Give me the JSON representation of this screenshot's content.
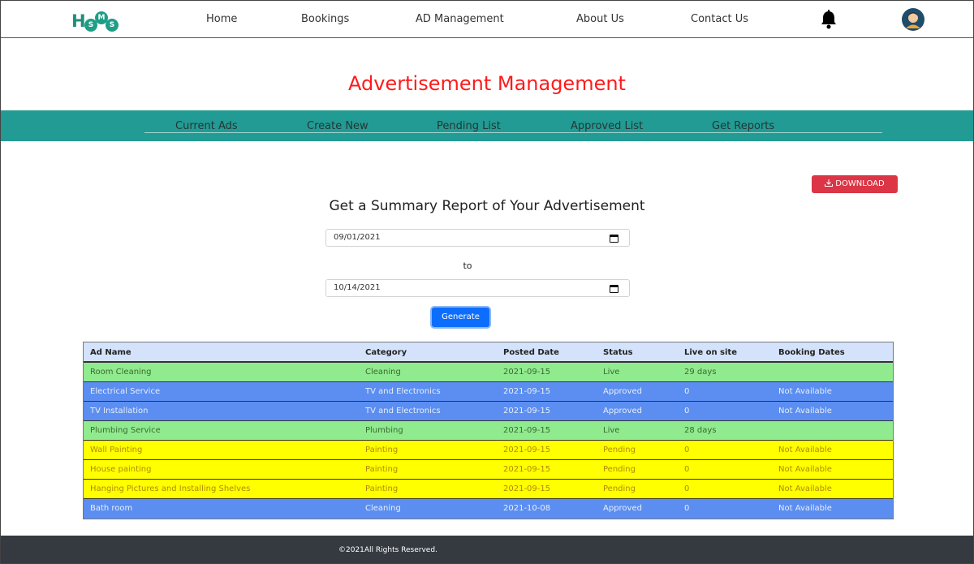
{
  "nav": {
    "logo_h": "H",
    "logo_m": "M",
    "logo_s1": "S",
    "logo_s2": "S",
    "links": [
      "Home",
      "Bookings",
      "AD Management",
      "About Us",
      "Contact Us"
    ],
    "icons": [
      "bell-icon",
      "avatar-icon"
    ]
  },
  "page_title": "Advertisement Management",
  "tabs": [
    "Current Ads",
    "Create New",
    "Pending List",
    "Approved List",
    "Get Reports"
  ],
  "download_label": "DOWNLOAD",
  "summary_title": "Get a Summary Report of Your Advertisement",
  "date_from": "09/01/2021",
  "to_label": "to",
  "date_to": "10/14/2021",
  "generate_label": "Generate",
  "table": {
    "headers": [
      "Ad Name",
      "Category",
      "Posted Date",
      "Status",
      "Live on site",
      "Booking Dates"
    ],
    "rows": [
      {
        "name": "Room Cleaning",
        "category": "Cleaning",
        "date": "2021-09-15",
        "status": "Live",
        "live": "29 days",
        "booking": "",
        "color": "#90ea8e"
      },
      {
        "name": "Electrical Service",
        "category": "TV and Electronics",
        "date": "2021-09-15",
        "status": "Approved",
        "live": "0",
        "booking": "Not Available",
        "color": "#5b8ef0"
      },
      {
        "name": "TV Installation",
        "category": "TV and Electronics",
        "date": "2021-09-15",
        "status": "Approved",
        "live": "0",
        "booking": "Not Available",
        "color": "#5b8ef0"
      },
      {
        "name": "Plumbing Service",
        "category": "Plumbing",
        "date": "2021-09-15",
        "status": "Live",
        "live": "28 days",
        "booking": "",
        "color": "#90ea8e"
      },
      {
        "name": "Wall Painting",
        "category": "Painting",
        "date": "2021-09-15",
        "status": "Pending",
        "live": "0",
        "booking": "Not Available",
        "color": "#ffff00"
      },
      {
        "name": "House painting",
        "category": "Painting",
        "date": "2021-09-15",
        "status": "Pending",
        "live": "0",
        "booking": "Not Available",
        "color": "#ffff00"
      },
      {
        "name": "Hanging Pictures and Installing Shelves",
        "category": "Painting",
        "date": "2021-09-15",
        "status": "Pending",
        "live": "0",
        "booking": "Not Available",
        "color": "#ffff00"
      },
      {
        "name": "Bath room",
        "category": "Cleaning",
        "date": "2021-10-08",
        "status": "Approved",
        "live": "0",
        "booking": "Not Available",
        "color": "#5b8ef0"
      }
    ]
  },
  "footer_text": "©2021All Rights Reserved.",
  "colors": {
    "title": "#ff1a1a",
    "tabband": "#229b94",
    "download": "#dc3545",
    "generate": "#0d6efd",
    "footer": "#343a40",
    "text_on_green": "#3a6a32",
    "text_on_blue": "#e8eefc",
    "text_on_yellow": "#b08a00"
  }
}
